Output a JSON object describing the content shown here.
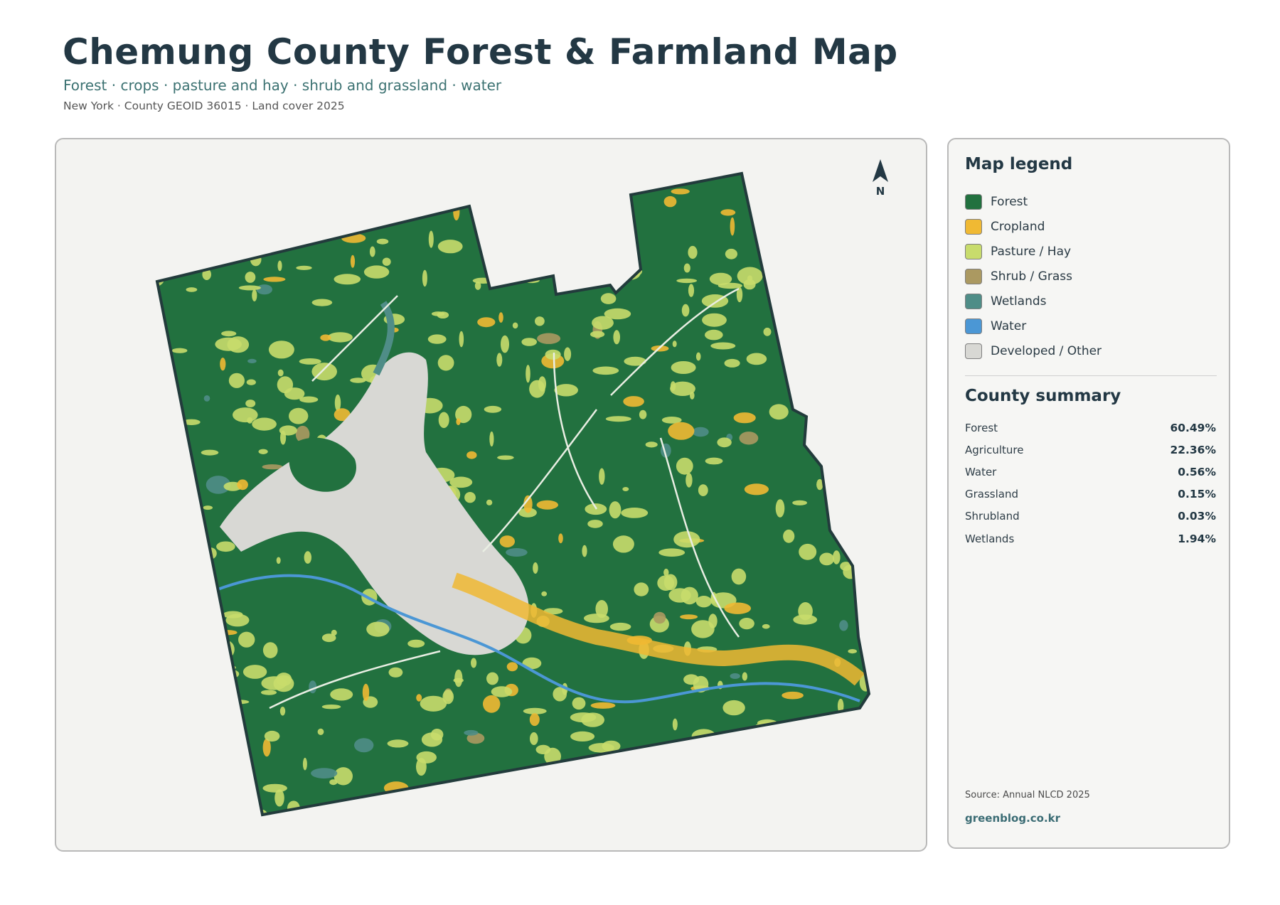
{
  "header": {
    "title": "Chemung County Forest & Farmland Map",
    "subtitle": "Forest · crops · pasture and hay · shrub and grassland · water",
    "meta": "New York · County GEOID 36015 · Land cover 2025"
  },
  "map": {
    "north_label": "N",
    "north_icon": "north-arrow-icon",
    "colors": {
      "forest": "#22713f",
      "cropland": "#f0b933",
      "pasture": "#c8dc6c",
      "shrub": "#ab9961",
      "wetlands": "#4f8d87",
      "water": "#4b97d5",
      "developed": "#d8d8d4",
      "boundary": "#223b3c"
    }
  },
  "legend": {
    "title": "Map legend",
    "items": [
      {
        "label": "Forest",
        "color": "#22713f"
      },
      {
        "label": "Cropland",
        "color": "#f0b933"
      },
      {
        "label": "Pasture / Hay",
        "color": "#c8dc6c"
      },
      {
        "label": "Shrub / Grass",
        "color": "#ab9961"
      },
      {
        "label": "Wetlands",
        "color": "#4f8d87"
      },
      {
        "label": "Water",
        "color": "#4b97d5"
      },
      {
        "label": "Developed / Other",
        "color": "#d8d8d4"
      }
    ]
  },
  "summary": {
    "title": "County summary",
    "rows": [
      {
        "label": "Forest",
        "value": "60.49%"
      },
      {
        "label": "Agriculture",
        "value": "22.36%"
      },
      {
        "label": "Water",
        "value": "0.56%"
      },
      {
        "label": "Grassland",
        "value": "0.15%"
      },
      {
        "label": "Shrubland",
        "value": "0.03%"
      },
      {
        "label": "Wetlands",
        "value": "1.94%"
      }
    ]
  },
  "footer": {
    "source": "Source: Annual NLCD 2025",
    "brand": "greenblog.co.kr"
  }
}
